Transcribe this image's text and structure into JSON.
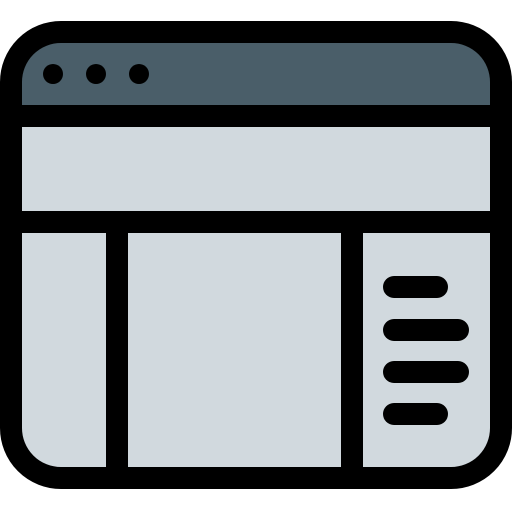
{
  "icon": {
    "name": "browser-layout-icon",
    "colors": {
      "outline": "#000000",
      "title_bar": "#4a5e69",
      "panel": "#d1d9de",
      "background": "#ffffff"
    },
    "window_dots": 3,
    "sidebar_lines": 4
  }
}
